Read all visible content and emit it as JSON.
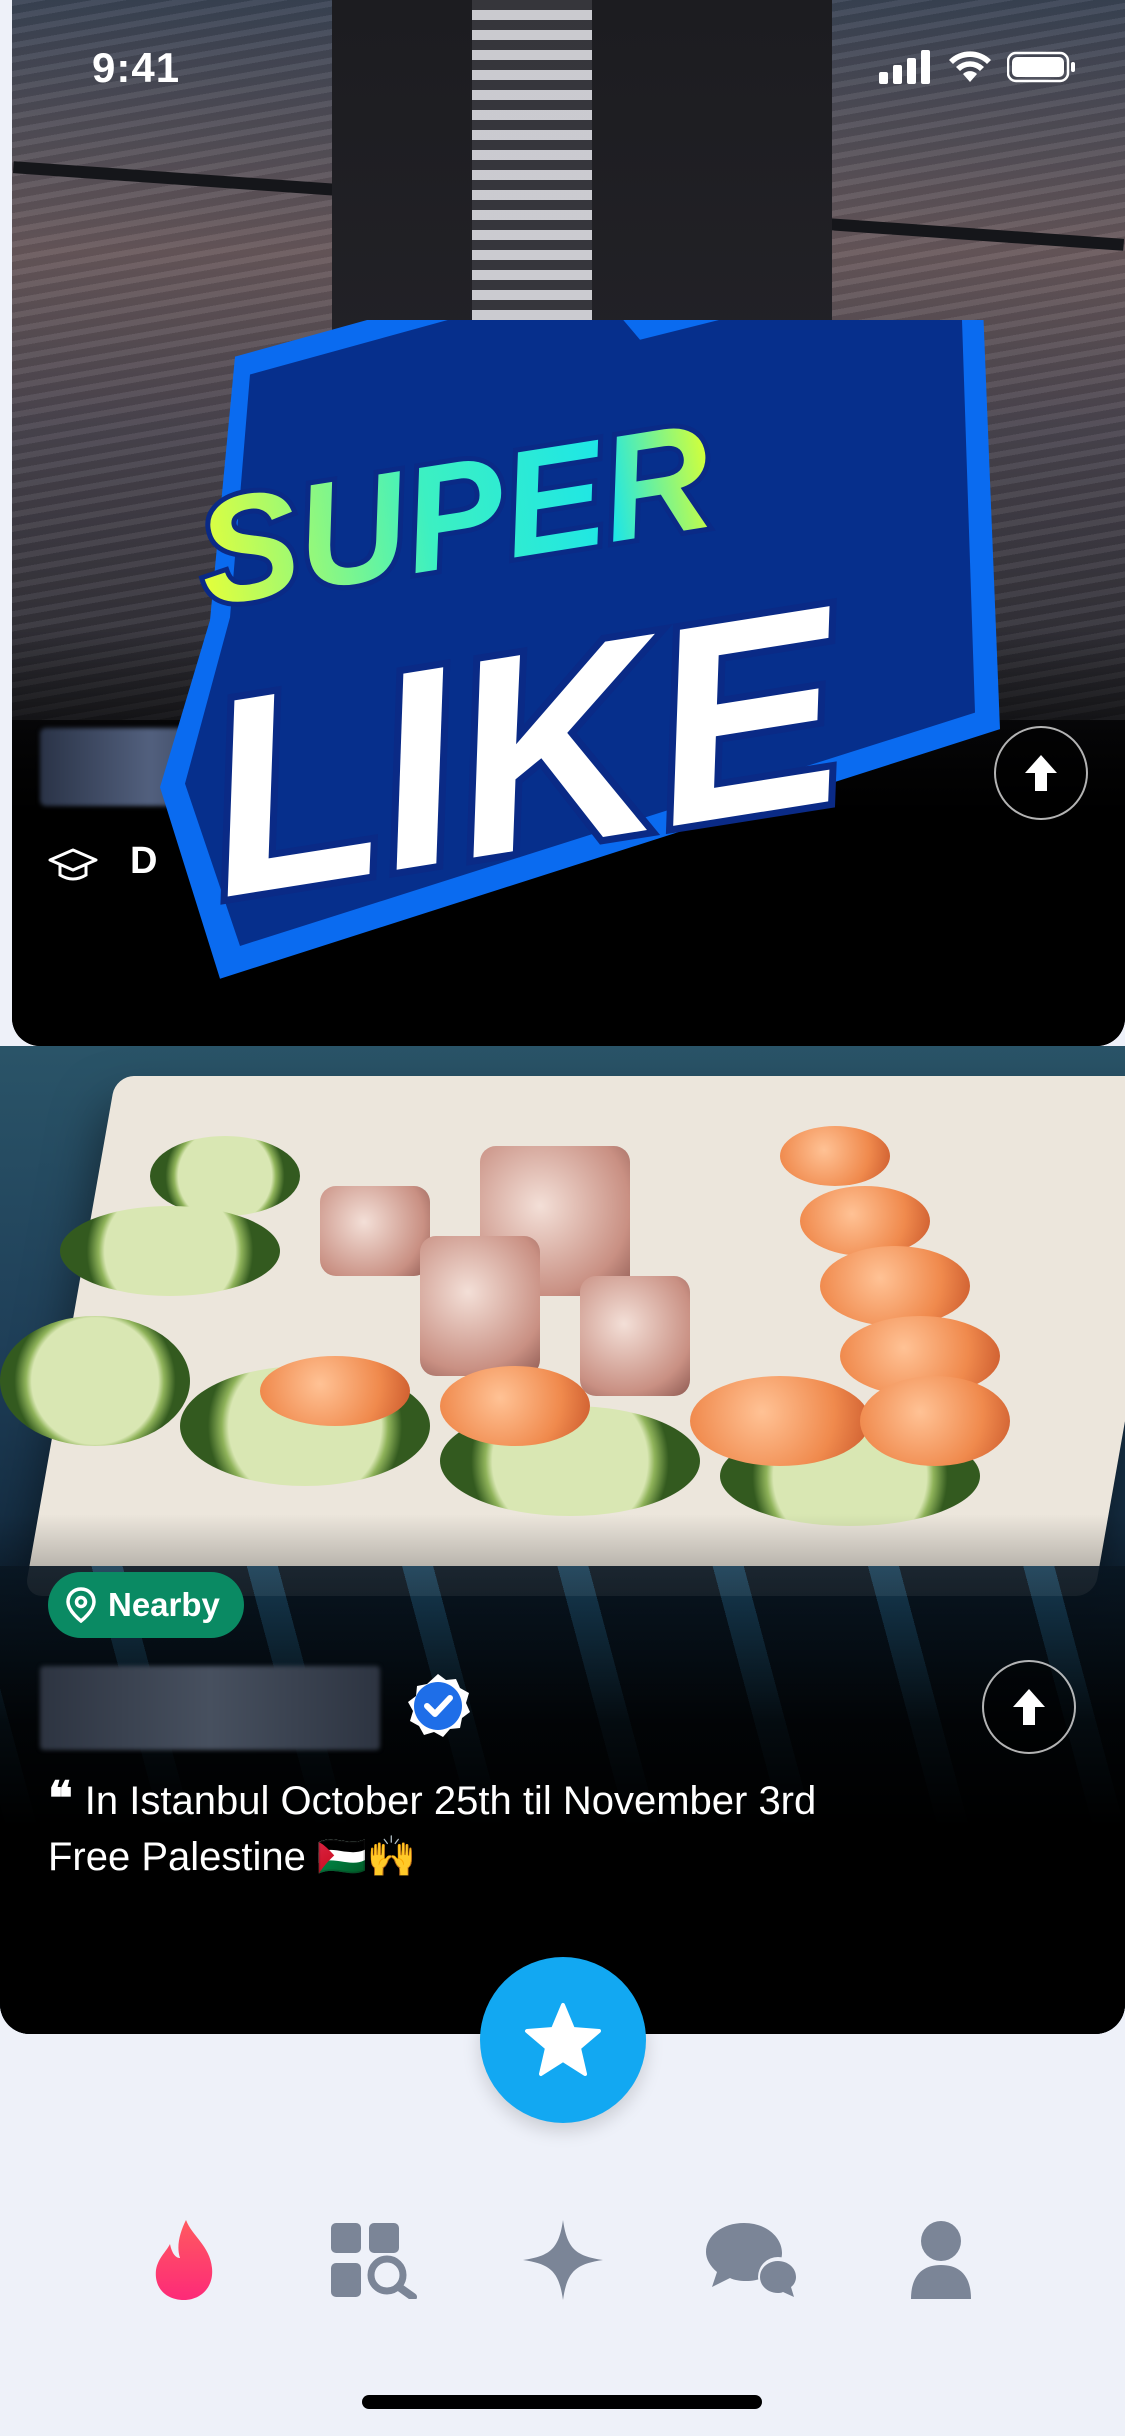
{
  "status_bar": {
    "time": "9:41"
  },
  "back_card": {
    "school_initial": "D"
  },
  "overlay": {
    "super_label": "SUPER",
    "like_label": "LIKE"
  },
  "front_card": {
    "badge": "Nearby",
    "bio_line1": "In Istanbul October 25th til November 3rd",
    "bio_line2": "Free Palestine 🇵🇸🙌"
  },
  "tab_bar": {
    "items": [
      "flame-icon",
      "explore-icon",
      "sparkle-icon",
      "chat-icon",
      "profile-icon"
    ],
    "active_color": "#fd2a66",
    "inactive_color": "#7b8597"
  },
  "colors": {
    "accent_blue": "#12a8f2",
    "nearby_green": "#0a8a63"
  }
}
